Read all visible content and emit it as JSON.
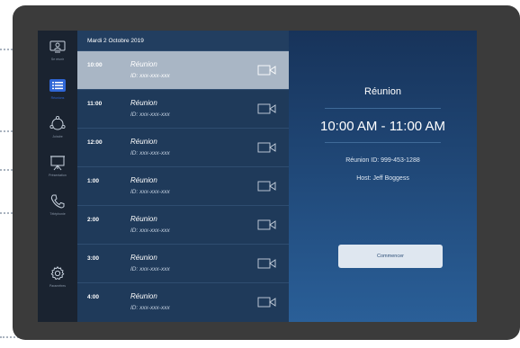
{
  "sidebar": {
    "items": [
      {
        "label": "Se réunir",
        "icon": "screen-person-icon",
        "active": false
      },
      {
        "label": "Réunions",
        "icon": "list-icon",
        "active": true
      },
      {
        "label": "Joindre",
        "icon": "join-icon",
        "active": false
      },
      {
        "label": "Présentation",
        "icon": "presentation-icon",
        "active": false
      },
      {
        "label": "Téléphonie",
        "icon": "phone-icon",
        "active": false
      },
      {
        "label": "Paramètres",
        "icon": "gear-icon",
        "active": false
      }
    ]
  },
  "schedule": {
    "date": "Mardi 2 Octobre 2019",
    "rows": [
      {
        "time": "10:00",
        "title": "Réunion",
        "meeting": "ID: xxx-xxx-xxx"
      },
      {
        "time": "11:00",
        "title": "Réunion",
        "meeting": "ID: xxx-xxx-xxx"
      },
      {
        "time": "12:00",
        "title": "Réunion",
        "meeting": "ID: xxx-xxx-xxx"
      },
      {
        "time": "1:00",
        "title": "Réunion",
        "meeting": "ID: xxx-xxx-xxx"
      },
      {
        "time": "2:00",
        "title": "Réunion",
        "meeting": "ID: xxx-xxx-xxx"
      },
      {
        "time": "3:00",
        "title": "Réunion",
        "meeting": "ID: xxx-xxx-xxx"
      },
      {
        "time": "4:00",
        "title": "Réunion",
        "meeting": "ID: xxx-xxx-xxx"
      }
    ]
  },
  "detail": {
    "title": "Réunion",
    "time_range": "10:00 AM - 11:00 AM",
    "meeting_id": "Réunion  ID: 999-453-1288",
    "host": "Host: Jeff Boggess",
    "start_label": "Commencer"
  },
  "colors": {
    "sidebar_bg": "#1a2330",
    "list_bg": "#1f3a5a",
    "selected_row": "#a9b6c5",
    "accent_active": "#2f66d6"
  }
}
